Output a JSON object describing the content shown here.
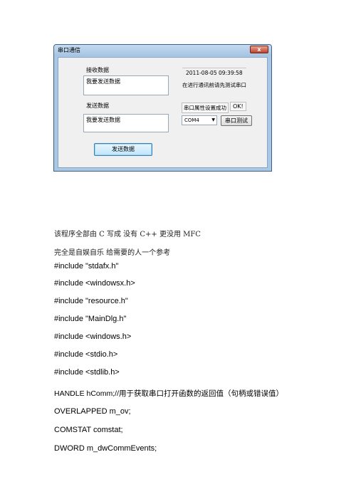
{
  "dialog": {
    "title": "串口通信",
    "close_glyph": "x",
    "receive_label": "接收数据",
    "receive_value": "我要发送数据",
    "send_label": "发送数据",
    "send_value": "我要发送数据",
    "datetime": "2011-08-05 09:39:58",
    "hint": "在进行通讯前请先测试串口",
    "port_status_label": "串口属性设置成功",
    "ok_label": "OK!",
    "com_selected": "COM4",
    "port_test_button": "串口测试",
    "send_button": "发送数据"
  },
  "document": {
    "lines": [
      "该程序全部由 C 写成   没有 C++   更没用 MFC",
      "完全是自娱自乐   给需要的人一个参考",
      "#include \"stdafx.h\"",
      "#include <windowsx.h>",
      "#include \"resource.h\"",
      "#include \"MainDlg.h\"",
      "#include <windows.h>",
      "#include <stdio.h>",
      "#include <stdlib.h>",
      "HANDLE hComm;//用于获取串口打开函数的返回值（句柄或错误值）",
      "OVERLAPPED m_ov;",
      "COMSTAT comstat;",
      "DWORD m_dwCommEvents;"
    ]
  }
}
